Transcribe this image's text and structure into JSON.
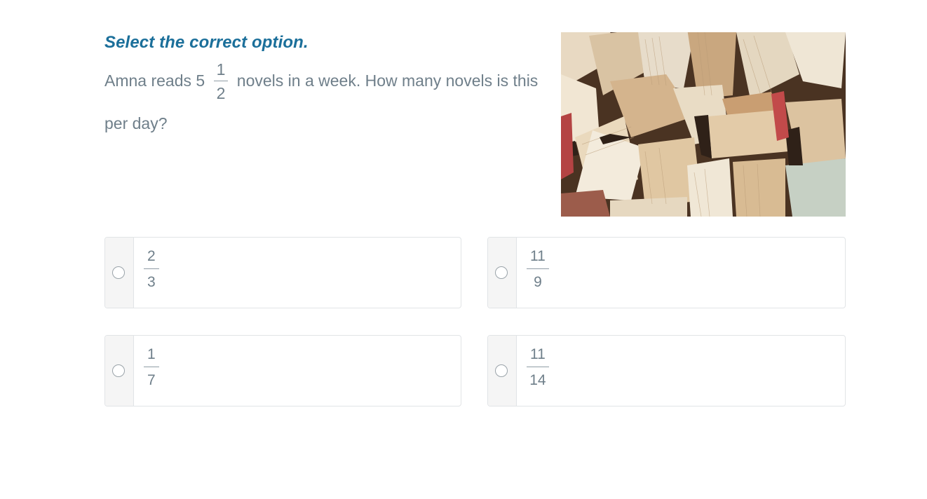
{
  "instruction": "Select the correct option.",
  "question": {
    "before": "Amna reads",
    "whole": "5",
    "numerator": "1",
    "denominator": "2",
    "after": "novels in a week. How many novels is this per day?"
  },
  "image": {
    "alt": "books"
  },
  "options": [
    {
      "numerator": "2",
      "denominator": "3"
    },
    {
      "numerator": "11",
      "denominator": "9"
    },
    {
      "numerator": "1",
      "denominator": "7"
    },
    {
      "numerator": "11",
      "denominator": "14"
    }
  ],
  "colors": {
    "accent": "#1b6f9a",
    "text": "#6f7f8a",
    "border": "#e1e4e6"
  }
}
